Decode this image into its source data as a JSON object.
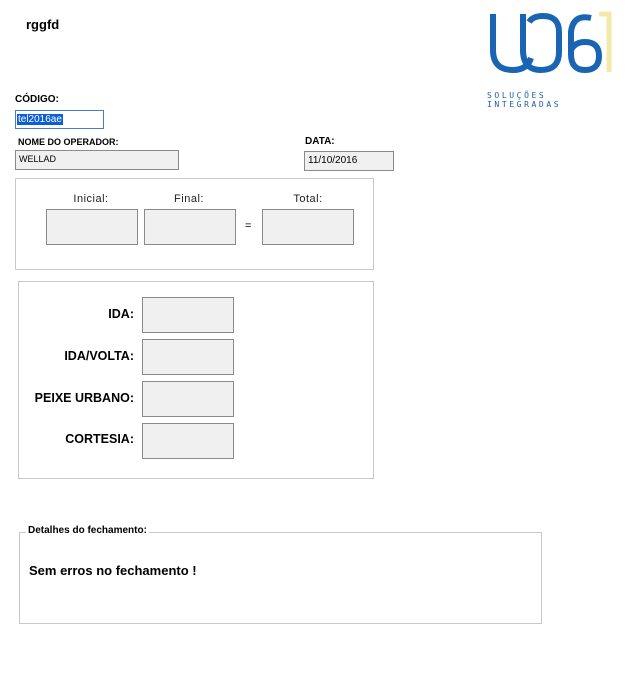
{
  "window": {
    "title": "rggfd"
  },
  "logo": {
    "tagline": "SOLUÇÕES INTEGRADAS",
    "primary_color": "#1a64b4",
    "accent_color": "#f5e9a8"
  },
  "header": {
    "codigo_label": "CÓDIGO:",
    "codigo_value": "tel2016ae",
    "operador_label": "NOME DO OPERADOR:",
    "operador_value": "WELLAD",
    "data_label": "DATA:",
    "data_value": "11/10/2016"
  },
  "counter": {
    "inicial_label": "Inicial:",
    "final_label": "Final:",
    "total_label": "Total:",
    "equals": "="
  },
  "tickets": {
    "ida_label": "IDA:",
    "ida_volta_label": "IDA/VOLTA:",
    "peixe_urbano_label": "PEIXE URBANO:",
    "cortesia_label": "CORTESIA:"
  },
  "details": {
    "legend": "Detalhes do fechamento:",
    "message": "Sem erros no fechamento !"
  }
}
